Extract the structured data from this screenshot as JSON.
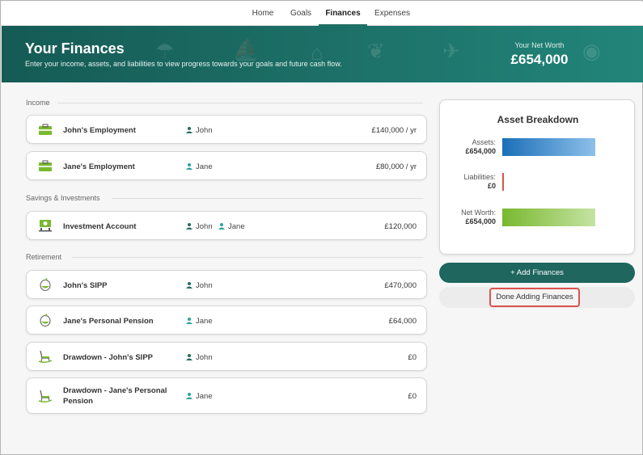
{
  "nav": {
    "items": [
      {
        "label": "Home",
        "active": false
      },
      {
        "label": "Goals",
        "active": false
      },
      {
        "label": "Finances",
        "active": true
      },
      {
        "label": "Expenses",
        "active": false
      }
    ]
  },
  "hero": {
    "title": "Your Finances",
    "subtitle": "Enter your income, assets, and liabilities to view progress towards your goals and future cash flow.",
    "net_worth_label": "Your Net Worth",
    "net_worth_value": "£654,000"
  },
  "sections": {
    "income": "Income",
    "savings": "Savings & Investments",
    "retirement": "Retirement"
  },
  "items": [
    {
      "name": "John's Employment",
      "name2": "",
      "owners": [
        "John"
      ],
      "value": "£140,000 / yr",
      "icon": "briefcase-icon"
    },
    {
      "name": "Jane's Employment",
      "name2": "",
      "owners": [
        "Jane"
      ],
      "value": "£80,000 / yr",
      "icon": "briefcase-icon"
    },
    {
      "name": "Investment Account",
      "name2": "",
      "owners": [
        "John",
        "Jane"
      ],
      "value": "£120,000",
      "icon": "bank-icon"
    },
    {
      "name": "John's SIPP",
      "name2": "",
      "owners": [
        "John"
      ],
      "value": "£470,000",
      "icon": "nest-egg-icon"
    },
    {
      "name": "Jane's Personal Pension",
      "name2": "",
      "owners": [
        "Jane"
      ],
      "value": "£64,000",
      "icon": "nest-egg-icon"
    },
    {
      "name": "Drawdown - John's SIPP",
      "name2": "",
      "owners": [
        "John"
      ],
      "value": "£0",
      "icon": "rocking-chair-icon"
    },
    {
      "name": "Drawdown - Jane's Personal",
      "name2": "Pension",
      "owners": [
        "Jane"
      ],
      "value": "£0",
      "icon": "rocking-chair-icon"
    }
  ],
  "breakdown": {
    "title": "Asset Breakdown",
    "assets_label": "Assets:",
    "assets_value": "£654,000",
    "liabilities_label": "Liabilities:",
    "liabilities_value": "£0",
    "networth_label": "Net Worth:",
    "networth_value": "£654,000",
    "colors": {
      "assets": "#1a6fb8",
      "liabilities": "#d9534f",
      "networth": "#7ab830"
    }
  },
  "actions": {
    "add_label": "+ Add Finances",
    "done_label": "Done Adding Finances"
  }
}
